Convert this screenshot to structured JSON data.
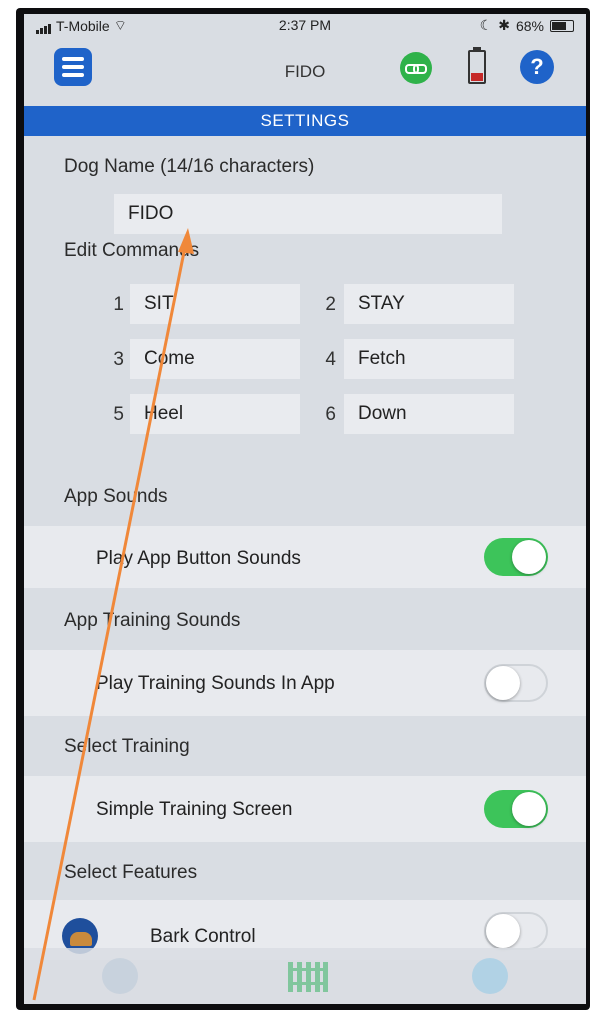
{
  "status_bar": {
    "carrier": "T-Mobile",
    "time": "2:37 PM",
    "battery": "68%"
  },
  "nav": {
    "title": "FIDO",
    "menu_icon": "menu-icon",
    "link_icon": "link-icon",
    "battery_icon": "battery-icon",
    "help_label": "?"
  },
  "banner": "SETTINGS",
  "dog_name": {
    "label": "Dog Name (14/16 characters)",
    "value": "FIDO"
  },
  "commands": {
    "label": "Edit Commands",
    "items": [
      {
        "num": "1",
        "value": "SIT"
      },
      {
        "num": "2",
        "value": "STAY"
      },
      {
        "num": "3",
        "value": "Come"
      },
      {
        "num": "4",
        "value": "Fetch"
      },
      {
        "num": "5",
        "value": "Heel"
      },
      {
        "num": "6",
        "value": "Down"
      }
    ]
  },
  "app_sounds": {
    "header": "App Sounds",
    "row_label": "Play App Button Sounds",
    "enabled": true
  },
  "training_sounds": {
    "header": "App Training Sounds",
    "row_label": "Play Training Sounds In App",
    "enabled": false
  },
  "select_training": {
    "header": "Select Training",
    "row_label": "Simple Training Screen",
    "enabled": true
  },
  "select_features": {
    "header": "Select Features",
    "row_label": "Bark Control",
    "enabled": false
  },
  "colors": {
    "accent_blue": "#1f63c9",
    "toggle_on": "#3dc45a",
    "annotation_arrow": "#f0883a"
  },
  "tabs": [
    "dog-icon",
    "fence-icon",
    "remote-icon"
  ]
}
